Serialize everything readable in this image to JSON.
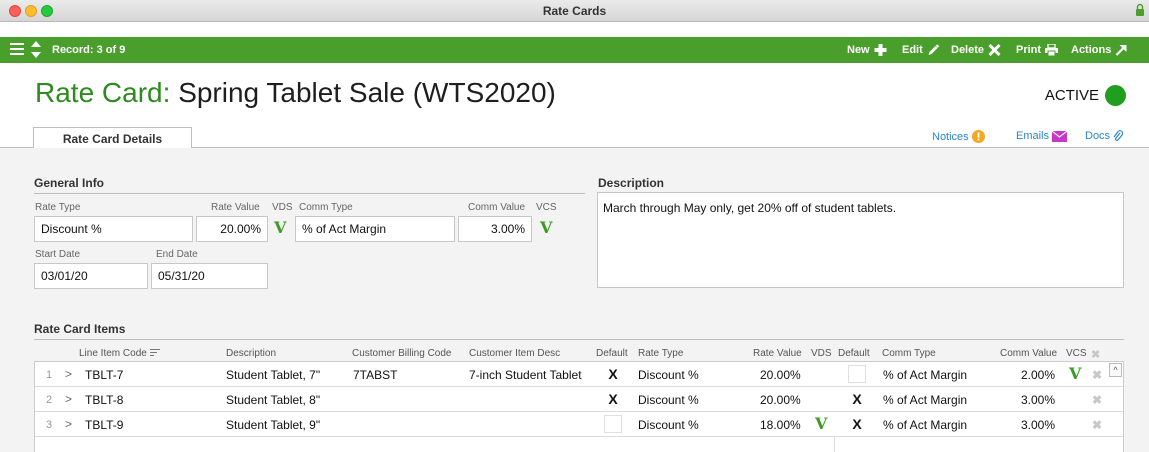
{
  "window": {
    "title": "Rate Cards"
  },
  "toolbar": {
    "record": "Record: 3 of 9",
    "new_label": "New",
    "edit_label": "Edit",
    "delete_label": "Delete",
    "print_label": "Print",
    "actions_label": "Actions"
  },
  "header": {
    "prefix": "Rate Card:",
    "name": "Spring Tablet Sale  (WTS2020)",
    "status": "ACTIVE",
    "status_color": "#1f9e1f"
  },
  "tabs": {
    "active": "Rate Card Details"
  },
  "links": {
    "notices": "Notices",
    "emails": "Emails",
    "docs": "Docs"
  },
  "general": {
    "heading": "General Info",
    "rate_type_label": "Rate Type",
    "rate_type": "Discount %",
    "rate_value_label": "Rate Value",
    "rate_value": "20.00%",
    "vds_label": "VDS",
    "comm_type_label": "Comm Type",
    "comm_type": "% of Act Margin",
    "comm_value_label": "Comm Value",
    "comm_value": "3.00%",
    "vcs_label": "VCS",
    "check_mark": "V",
    "start_label": "Start Date",
    "start": "03/01/20",
    "end_label": "End Date",
    "end": "05/31/20"
  },
  "description": {
    "heading": "Description",
    "text": "March through May only, get 20% off of student tablets."
  },
  "items": {
    "heading": "Rate Card Items",
    "columns": {
      "code": "Line Item Code",
      "desc": "Description",
      "billing": "Customer Billing Code",
      "cust_desc": "Customer Item Desc",
      "default": "Default",
      "rate_type": "Rate Type",
      "rate_value": "Rate Value",
      "vds": "VDS",
      "default2": "Default",
      "comm_type": "Comm Type",
      "comm_value": "Comm Value",
      "vcs": "VCS"
    },
    "rows": [
      {
        "num": "1",
        "arrow": ">",
        "code": "TBLT-7",
        "desc": "Student Tablet, 7\"",
        "billing": "7TABST",
        "cust_desc": "7-inch Student Tablet",
        "default": "X",
        "rate_type": "Discount %",
        "rate_value": "20.00%",
        "vds": "",
        "default2": "",
        "comm_type": "% of Act Margin",
        "comm_value": "2.00%",
        "vcs": "V"
      },
      {
        "num": "2",
        "arrow": ">",
        "code": "TBLT-8",
        "desc": "Student Tablet, 8\"",
        "billing": "",
        "cust_desc": "",
        "default": "X",
        "rate_type": "Discount %",
        "rate_value": "20.00%",
        "vds": "",
        "default2": "X",
        "comm_type": "% of Act Margin",
        "comm_value": "3.00%",
        "vcs": ""
      },
      {
        "num": "3",
        "arrow": ">",
        "code": "TBLT-9",
        "desc": "Student Tablet, 9\"",
        "billing": "",
        "cust_desc": "",
        "default": "",
        "rate_type": "Discount %",
        "rate_value": "18.00%",
        "vds": "V",
        "default2": "X",
        "comm_type": "% of Act Margin",
        "comm_value": "3.00%",
        "vcs": ""
      }
    ]
  },
  "colors": {
    "brand": "#4a9f2c",
    "accent_text": "#2e8b1f",
    "link": "#2a86c8",
    "notice": "#f5a623",
    "email": "#c936c9"
  }
}
